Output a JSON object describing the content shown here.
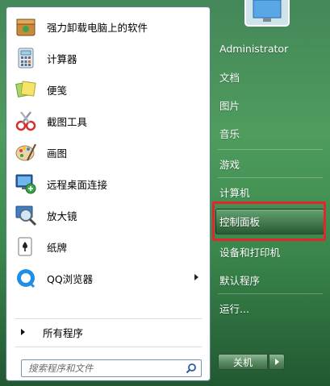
{
  "programs": [
    {
      "label": "强力卸载电脑上的软件",
      "icon": "uninstall-box-icon"
    },
    {
      "label": "计算器",
      "icon": "calculator-icon"
    },
    {
      "label": "便笺",
      "icon": "sticky-notes-icon"
    },
    {
      "label": "截图工具",
      "icon": "snipping-tool-icon"
    },
    {
      "label": "画图",
      "icon": "paint-palette-icon"
    },
    {
      "label": "远程桌面连接",
      "icon": "remote-desktop-icon"
    },
    {
      "label": "放大镜",
      "icon": "magnifier-icon"
    },
    {
      "label": "纸牌",
      "icon": "solitaire-cards-icon"
    },
    {
      "label": "QQ浏览器",
      "icon": "qq-browser-icon"
    }
  ],
  "all_programs": "所有程序",
  "search": {
    "placeholder": "搜索程序和文件"
  },
  "right_menu": {
    "user": "Administrator",
    "documents": "文档",
    "pictures": "图片",
    "music": "音乐",
    "games": "游戏",
    "computer": "计算机",
    "control_panel": "控制面板",
    "devices_printers": "设备和打印机",
    "default_programs": "默认程序",
    "run": "运行..."
  },
  "shutdown": {
    "label": "关机"
  },
  "colors": {
    "highlight_border": "#e3262d",
    "desktop_green": "#3a8a4c"
  }
}
